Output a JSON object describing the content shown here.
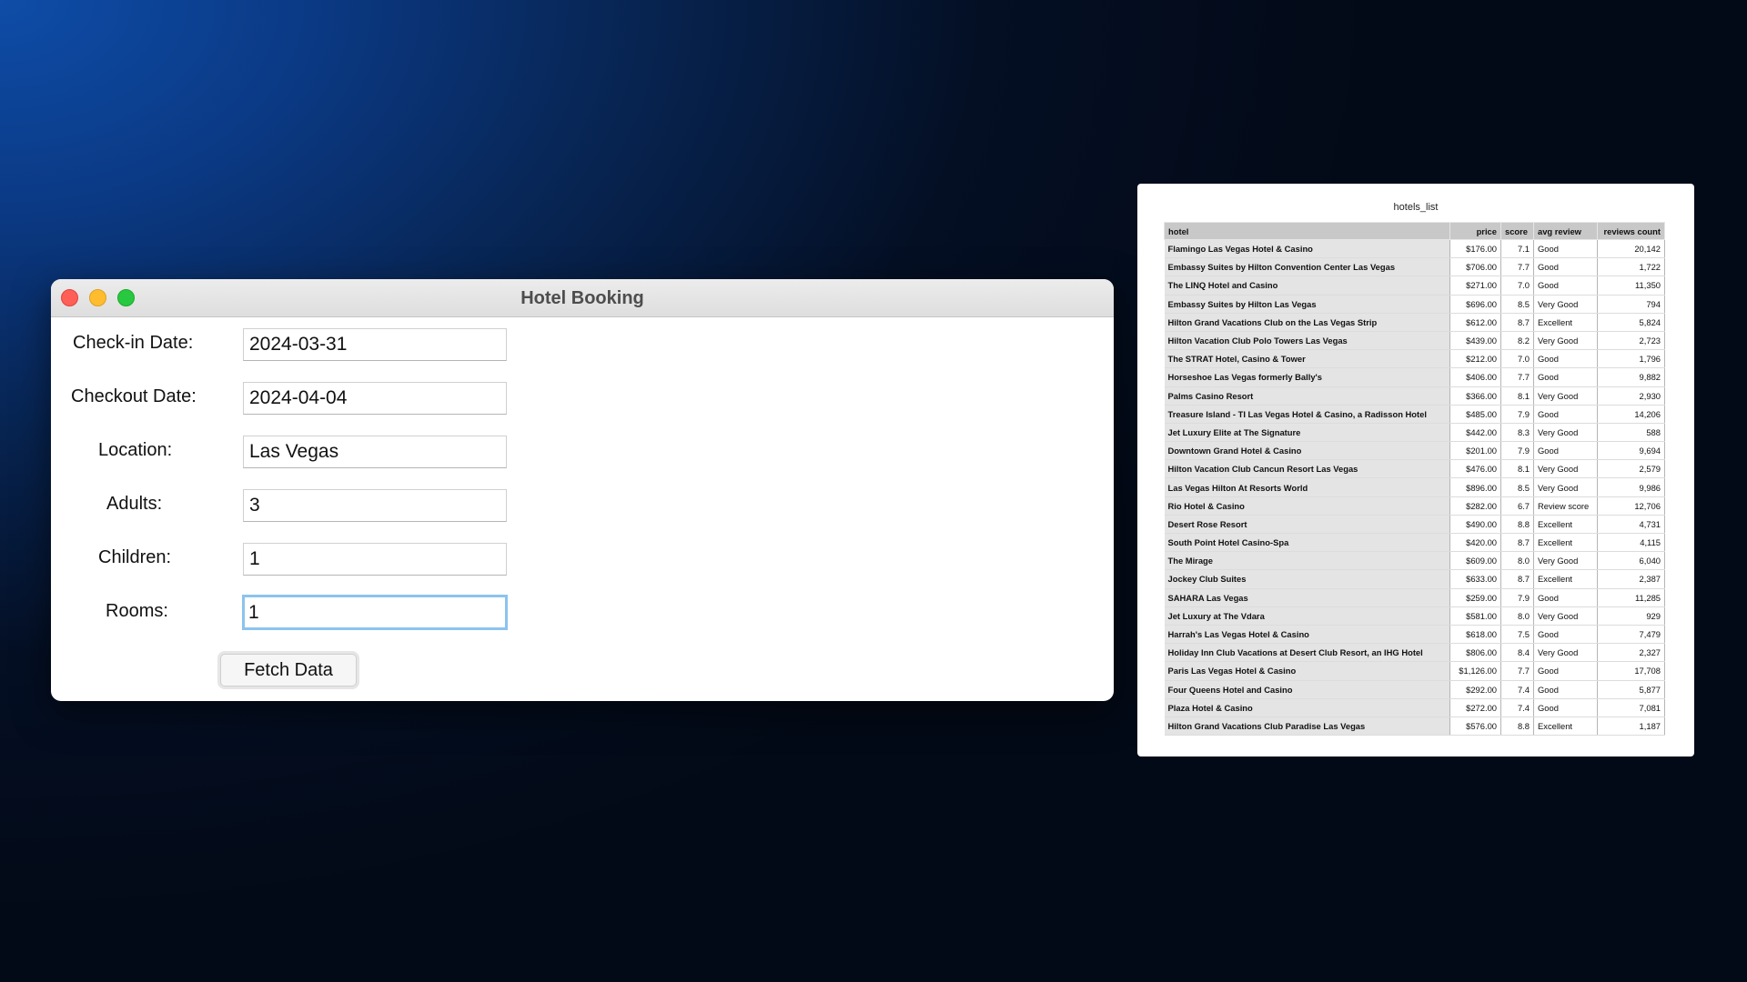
{
  "window": {
    "title": "Hotel Booking"
  },
  "form": {
    "checkin_label": "Check-in Date:",
    "checkin_value": "2024-03-31",
    "checkout_label": "Checkout Date:",
    "checkout_value": "2024-04-04",
    "location_label": "Location:",
    "location_value": "Las Vegas",
    "adults_label": "Adults:",
    "adults_value": "3",
    "children_label": "Children:",
    "children_value": "1",
    "rooms_label": "Rooms:",
    "rooms_value": "1",
    "fetch_button": "Fetch Data"
  },
  "hotels_list": {
    "title": "hotels_list",
    "columns": [
      "hotel",
      "price",
      "score",
      "avg review",
      "reviews count"
    ],
    "rows": [
      [
        "Flamingo Las Vegas Hotel & Casino",
        "$176.00",
        "7.1",
        "Good",
        "20,142"
      ],
      [
        "Embassy Suites by Hilton Convention Center Las Vegas",
        "$706.00",
        "7.7",
        "Good",
        "1,722"
      ],
      [
        "The LINQ Hotel and Casino",
        "$271.00",
        "7.0",
        "Good",
        "11,350"
      ],
      [
        "Embassy Suites by Hilton Las Vegas",
        "$696.00",
        "8.5",
        "Very Good",
        "794"
      ],
      [
        "Hilton Grand Vacations Club on the Las Vegas Strip",
        "$612.00",
        "8.7",
        "Excellent",
        "5,824"
      ],
      [
        "Hilton Vacation Club Polo Towers Las Vegas",
        "$439.00",
        "8.2",
        "Very Good",
        "2,723"
      ],
      [
        "The STRAT Hotel, Casino & Tower",
        "$212.00",
        "7.0",
        "Good",
        "1,796"
      ],
      [
        "Horseshoe Las Vegas formerly Bally's",
        "$406.00",
        "7.7",
        "Good",
        "9,882"
      ],
      [
        "Palms Casino Resort",
        "$366.00",
        "8.1",
        "Very Good",
        "2,930"
      ],
      [
        "Treasure Island - TI Las Vegas Hotel & Casino, a Radisson Hotel",
        "$485.00",
        "7.9",
        "Good",
        "14,206"
      ],
      [
        "Jet Luxury Elite at The Signature",
        "$442.00",
        "8.3",
        "Very Good",
        "588"
      ],
      [
        "Downtown Grand Hotel & Casino",
        "$201.00",
        "7.9",
        "Good",
        "9,694"
      ],
      [
        "Hilton Vacation Club Cancun Resort Las Vegas",
        "$476.00",
        "8.1",
        "Very Good",
        "2,579"
      ],
      [
        "Las Vegas Hilton At Resorts World",
        "$896.00",
        "8.5",
        "Very Good",
        "9,986"
      ],
      [
        "Rio Hotel & Casino",
        "$282.00",
        "6.7",
        "Review score",
        "12,706"
      ],
      [
        "Desert Rose Resort",
        "$490.00",
        "8.8",
        "Excellent",
        "4,731"
      ],
      [
        "South Point Hotel Casino-Spa",
        "$420.00",
        "8.7",
        "Excellent",
        "4,115"
      ],
      [
        "The Mirage",
        "$609.00",
        "8.0",
        "Very Good",
        "6,040"
      ],
      [
        "Jockey Club Suites",
        "$633.00",
        "8.7",
        "Excellent",
        "2,387"
      ],
      [
        "SAHARA Las Vegas",
        "$259.00",
        "7.9",
        "Good",
        "11,285"
      ],
      [
        "Jet Luxury at The Vdara",
        "$581.00",
        "8.0",
        "Very Good",
        "929"
      ],
      [
        "Harrah's Las Vegas Hotel & Casino",
        "$618.00",
        "7.5",
        "Good",
        "7,479"
      ],
      [
        "Holiday Inn Club Vacations at Desert Club Resort, an IHG Hotel",
        "$806.00",
        "8.4",
        "Very Good",
        "2,327"
      ],
      [
        "Paris Las Vegas Hotel & Casino",
        "$1,126.00",
        "7.7",
        "Good",
        "17,708"
      ],
      [
        "Four Queens Hotel and Casino",
        "$292.00",
        "7.4",
        "Good",
        "5,877"
      ],
      [
        "Plaza Hotel & Casino",
        "$272.00",
        "7.4",
        "Good",
        "7,081"
      ],
      [
        "Hilton Grand Vacations Club Paradise Las Vegas",
        "$576.00",
        "8.8",
        "Excellent",
        "1,187"
      ]
    ]
  },
  "colors": {
    "close": "#fe5f57",
    "minimize": "#febc2e",
    "maximize": "#28c840",
    "focus_ring": "#8cc3ef"
  }
}
